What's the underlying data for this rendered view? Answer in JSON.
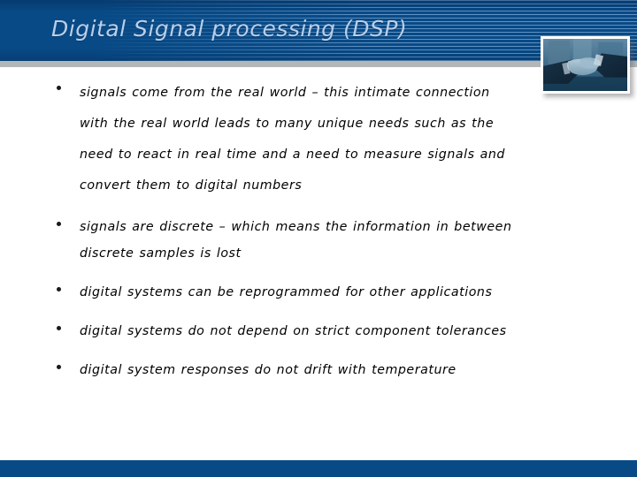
{
  "slide": {
    "title": "Digital Signal processing (DSP)",
    "colors": {
      "header_blue": "#084a86",
      "header_stripe": "#96bee6",
      "title_text": "#b9cfea",
      "divider_gray": "#b3b7b8",
      "body_text": "#000000",
      "footer_blue": "#084a86",
      "background": "#ffffff"
    },
    "bullets": [
      {
        "id": "bullet-signals-real-world",
        "lines": [
          "signals come from the real world – this intimate connection",
          "with the real world leads to many unique needs such as the",
          "need to react in real time and a need to measure signals and",
          "convert them to digital numbers"
        ]
      },
      {
        "id": "bullet-signals-discrete",
        "lines": [
          "signals are discrete – which means the information in between",
          "discrete samples is lost"
        ]
      },
      {
        "id": "bullet-reprogrammed",
        "lines": [
          "digital systems can be reprogrammed for other applications"
        ]
      },
      {
        "id": "bullet-tolerances",
        "lines": [
          "digital systems do not depend on strict component tolerances"
        ]
      },
      {
        "id": "bullet-temperature-drift",
        "lines": [
          "digital system responses do not drift with temperature"
        ]
      }
    ],
    "decoration": {
      "photo_name": "handshake-photo",
      "photo_description": "business handshake"
    }
  }
}
